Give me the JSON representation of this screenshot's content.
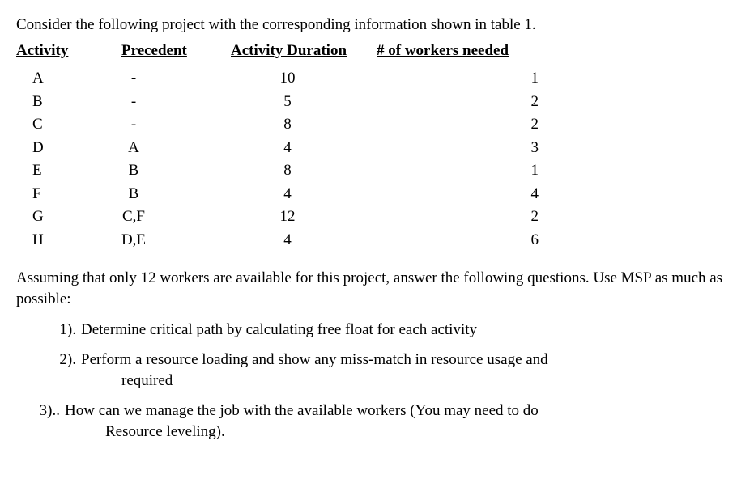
{
  "intro": "Consider the following project with the corresponding information shown in table 1.",
  "headers": {
    "activity": "Activity",
    "precedent": "Precedent",
    "duration": "Activity Duration",
    "workers": "# of workers needed"
  },
  "rows": [
    {
      "activity": "A",
      "precedent": "-",
      "duration": "10",
      "workers": "1"
    },
    {
      "activity": "B",
      "precedent": "-",
      "duration": "5",
      "workers": "2"
    },
    {
      "activity": "C",
      "precedent": "-",
      "duration": "8",
      "workers": "2"
    },
    {
      "activity": "D",
      "precedent": "A",
      "duration": "4",
      "workers": "3"
    },
    {
      "activity": "E",
      "precedent": "B",
      "duration": "8",
      "workers": "1"
    },
    {
      "activity": "F",
      "precedent": "B",
      "duration": "4",
      "workers": "4"
    },
    {
      "activity": "G",
      "precedent": "C,F",
      "duration": "12",
      "workers": "2"
    },
    {
      "activity": "H",
      "precedent": "D,E",
      "duration": "4",
      "workers": "6"
    }
  ],
  "assumption": "Assuming that only 12 workers are available for this project, answer the following questions. Use MSP as much as possible:",
  "questions": [
    {
      "num": "1).",
      "text": "Determine critical path by calculating free float for each activity",
      "sub": ""
    },
    {
      "num": "2).",
      "text": "Perform a resource loading and show any miss-match in resource usage and",
      "sub": "required"
    },
    {
      "num": "3)..",
      "text": "How can we manage the job with the available workers (You may need to do",
      "sub": "Resource leveling)."
    }
  ]
}
